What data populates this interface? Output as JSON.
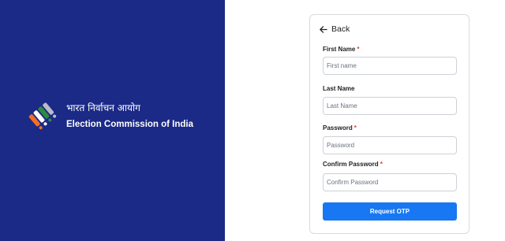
{
  "brand": {
    "hindi_name": "भारत निर्वाचन आयोग",
    "english_name": "Election Commission of India",
    "colors": {
      "panel": "#1b2a86",
      "saffron": "#f36f21",
      "green": "#2e8b3d",
      "white": "#ffffff",
      "grey": "#b9bcc4"
    }
  },
  "form": {
    "back_label": "Back",
    "fields": [
      {
        "label": "First Name",
        "required": true,
        "placeholder": "First name"
      },
      {
        "label": "Last Name",
        "required": false,
        "placeholder": "Last Name"
      },
      {
        "label": "Password",
        "required": true,
        "placeholder": "Password"
      },
      {
        "label": "Confirm Password",
        "required": true,
        "placeholder": "Confirm Password"
      }
    ],
    "required_marker": "*",
    "submit_label": "Request OTP",
    "accent": "#1877f2"
  }
}
